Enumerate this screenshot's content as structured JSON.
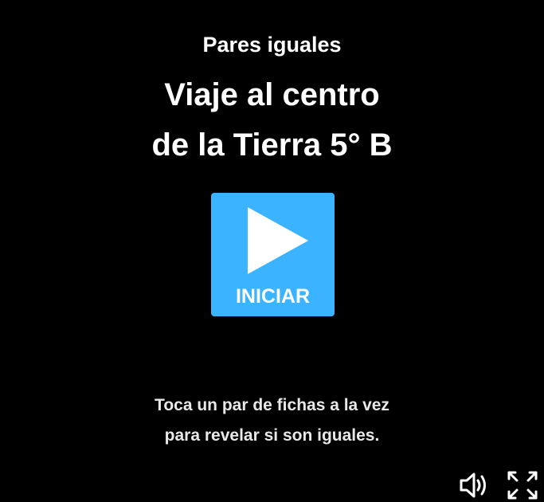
{
  "game": {
    "type_label": "Pares iguales",
    "title_line1": "Viaje al centro",
    "title_line2": "de la Tierra 5° B"
  },
  "start_button": {
    "label": "INICIAR",
    "color": "#3bb3ff",
    "icon": "play-icon"
  },
  "instructions": {
    "line1": "Toca un par de fichas a la vez",
    "line2": "para revelar si son iguales."
  },
  "controls": {
    "sound_icon": "speaker-icon",
    "fullscreen_icon": "fullscreen-icon"
  }
}
